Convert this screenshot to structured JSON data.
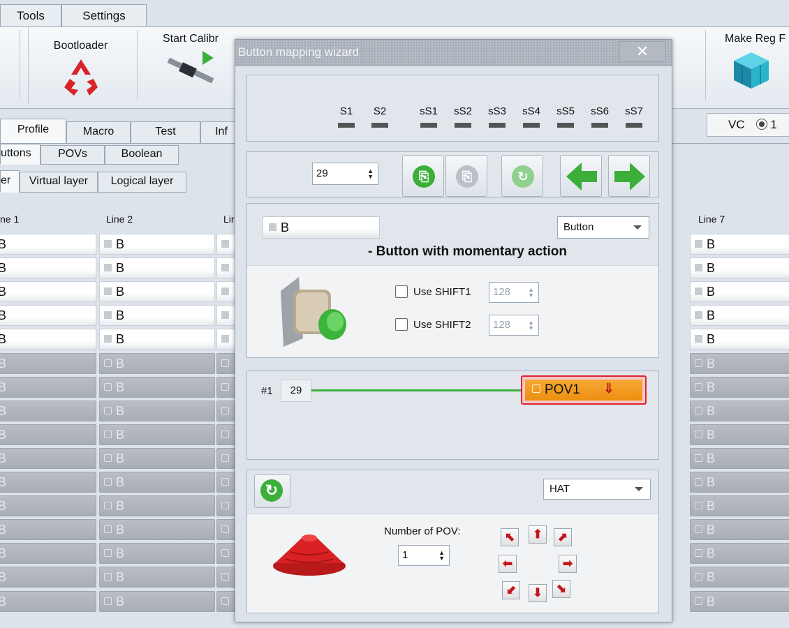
{
  "menu": {
    "tabs": [
      "Tools",
      "Settings"
    ]
  },
  "ribbon": {
    "buttons": [
      {
        "label": "Bootloader",
        "icon": "recycle-icon"
      },
      {
        "label": "Start Calibr",
        "icon": "caliper-play-icon"
      },
      {
        "label": "Make Reg F",
        "icon": "registry-cubes-icon"
      }
    ]
  },
  "main_tabs": [
    "Profile",
    "Macro",
    "Test",
    "Inf"
  ],
  "sub_tabs": [
    "uttons",
    "POVs",
    "Boolean"
  ],
  "layer_tabs": [
    "er",
    "Virtual layer",
    "Logical layer"
  ],
  "vc": {
    "label": "VC",
    "radio_value": "1"
  },
  "grid": {
    "headers": [
      "ne 1",
      "Line 2",
      "Lir",
      "Line 7"
    ],
    "cell_text": "B"
  },
  "dialog": {
    "title": "Button mapping wizard",
    "close_label": "✕",
    "switches": [
      "S1",
      "S2",
      "sS1",
      "sS2",
      "sS3",
      "sS4",
      "sS5",
      "sS6",
      "sS7"
    ],
    "nav": {
      "button_number": "29"
    },
    "button_field": "B",
    "type_select": "Button",
    "description": "- Button with momentary action",
    "shift1": {
      "label": "Use SHIFT1",
      "value": "128"
    },
    "shift2": {
      "label": "Use SHIFT2",
      "value": "128"
    },
    "mapping": {
      "index": "#1",
      "source": "29",
      "target": "POV1"
    },
    "pov": {
      "mode_select": "HAT",
      "number_label": "Number of POV:",
      "number_value": "1"
    }
  },
  "colors": {
    "accent_green": "#3cae3a",
    "pov_orange": "#f39c17",
    "pov_border": "#e0242c",
    "arrow_red": "#c0171b"
  }
}
